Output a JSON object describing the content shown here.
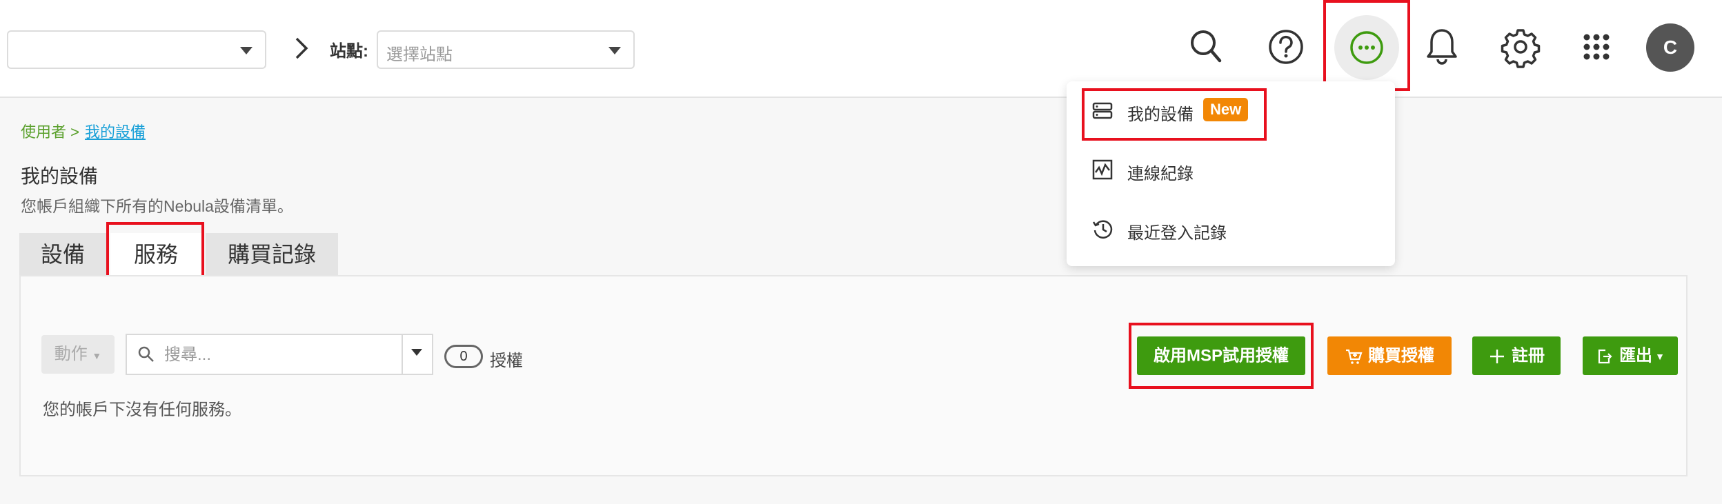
{
  "topbar": {
    "org_select": {
      "value": ""
    },
    "site_label": "站點:",
    "site_select": {
      "placeholder": "選擇站點"
    },
    "icons": [
      "search-icon",
      "help-icon",
      "more-icon",
      "bell-icon",
      "gear-icon",
      "apps-grid-icon"
    ],
    "avatar_initial": "C"
  },
  "more_menu": {
    "items": [
      {
        "label": "我的設備",
        "badge": "New",
        "icon": "device-list-icon"
      },
      {
        "label": "連線紀錄",
        "icon": "activity-chart-icon"
      },
      {
        "label": "最近登入記錄",
        "icon": "history-icon"
      }
    ]
  },
  "breadcrumb": {
    "parent": "使用者 >",
    "current": "我的設備"
  },
  "page": {
    "title": "我的設備",
    "subtitle": "您帳戶組織下所有的Nebula設備清單。"
  },
  "tabs": [
    {
      "label": "設備",
      "active": false
    },
    {
      "label": "服務",
      "active": true
    },
    {
      "label": "購買記錄",
      "active": false
    }
  ],
  "toolbar": {
    "action_label": "動作",
    "search_placeholder": "搜尋...",
    "toggle_value": "0",
    "toggle_label": "授權",
    "buttons": {
      "msp_trial": "啟用MSP試用授權",
      "buy_license": "購買授權",
      "register": "註冊",
      "export": "匯出"
    }
  },
  "empty_message": "您的帳戶下沒有任何服務。",
  "colors": {
    "green": "#3e9b0f",
    "orange": "#f28705",
    "breadcrumb_green": "#5aa02c",
    "link_blue": "#19a0d8",
    "highlight_red": "#e8101e"
  }
}
